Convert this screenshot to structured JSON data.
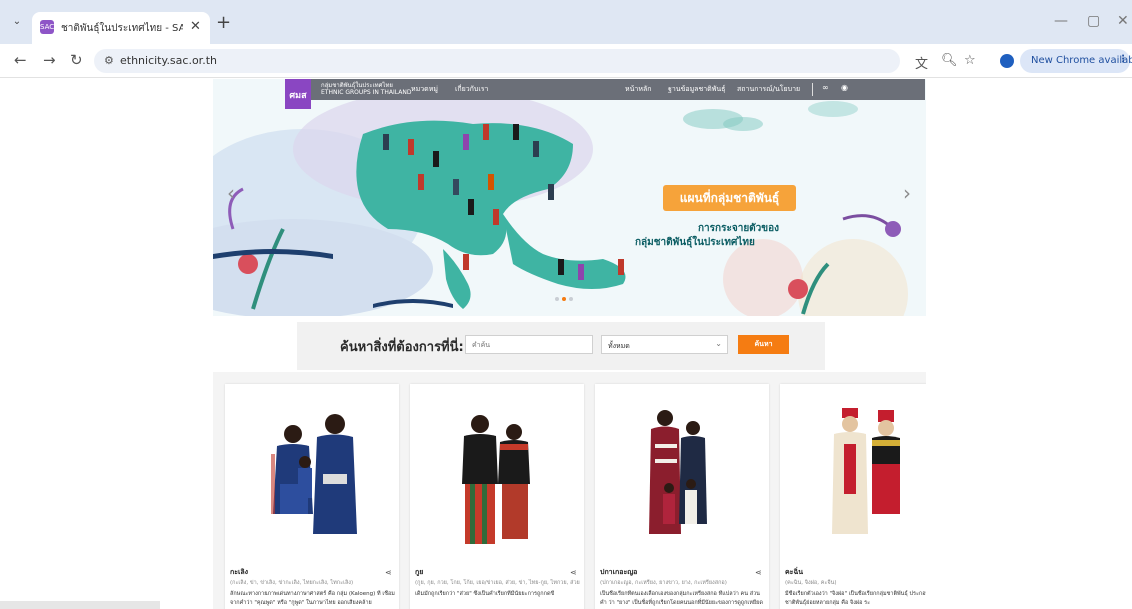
{
  "browser": {
    "tab_title": "ชาติพันธุ์ในประเทศไทย - SAC ETHN",
    "favicon_text": "SAC",
    "url": "ethnicity.sac.or.th",
    "update_label": "New Chrome available",
    "profile_initial": "👤"
  },
  "site_nav": {
    "logo_text": "ศมส",
    "org_name_th": "กลุ่มชาติพันธุ์ในประเทศไทย",
    "org_name_en": "ETHNIC GROUPS IN THAILAND",
    "links_left": [
      "หมวดหมู่",
      "เกี่ยวกับเรา"
    ],
    "links_right": [
      "หน้าหลัก",
      "ฐานข้อมูลชาติพันธุ์",
      "สถานการณ์/นโยบาย"
    ]
  },
  "hero": {
    "title": "แผนที่กลุ่มชาติพันธุ์",
    "subtitle_line1": "การกระจายตัวของ",
    "subtitle_line2": "กลุ่มชาติพันธุ์ในประเทศไทย",
    "slide_count": 3,
    "active_slide": 1
  },
  "search": {
    "label": "ค้นหาสิ่งที่ต้องการที่นี่:",
    "placeholder": "คำค้น",
    "select_value": "ทั้งหมด",
    "button_label": "ค้นหา"
  },
  "cards": [
    {
      "name": "กะเลิง",
      "aliases": "(กะเลิง, ข่า, ข่าเลิง, ข่ากะเลิง, ไทยกะเลิง, ไทกะเลิง)",
      "desc": "ลักษณะทางกายภาพเด่นทางภาษาศาสตร์ คือ กลุ่ม (Kaloeng) ที่ เชื่อมจากคำว่า \"คุณพูด\" หรือ \"กูพูด\" ในภาษาไทย ออกเสียงคล้าย",
      "colors": {
        "shirt": "#1f3a7a",
        "skirt": "#2d4e9e",
        "accent": "#c0392b"
      }
    },
    {
      "name": "กูย",
      "aliases": "(กูย, กุย, กวย, โกย, โก้ย, เยอ/ข่าเยอ, ส่วย, ข่า, ไทย-กูย, ไทกวย, ส่วยกวย, ส่วยกาเลา, เยอะลอย)",
      "desc": "เดิมมักถูกเรียกว่า \"ส่วย\" ซึ่งเป็นคำเรียกที่มีนัยยะการถูกกดขี่",
      "colors": {
        "shirt": "#1a1a1a",
        "skirt": "#c43a2a",
        "accent": "#2f6b3a"
      }
    },
    {
      "name": "ปกาเกอะญอ",
      "aliases": "(ปกาเกอะญอ, กะเหรี่ยง, ยางขาว, ยาง, กะเหรี่ยงสกอ)",
      "desc": "เป็นชื่อเรียกที่ตนเองเลือกเองของกลุ่มกะเหรี่ยงสกอ ที่แปลว่า คน ส่วนคำ ว่า \"ยาง\" เป็นชื่อที่ถูกเรียกโดยคนนอกที่มีนัยยะของการดูถูกเหยียด",
      "colors": {
        "shirt": "#8b1e2d",
        "skirt": "#b0243c",
        "accent": "#f2efe8"
      }
    },
    {
      "name": "คะฉิ่น",
      "aliases": "(คะฉิ่น, จิงผ่อ, คะจีน)",
      "desc": "มีชื่อเรียกตัวเองว่า \"จิงผ่อ\" เป็นชื่อเรียกกลุ่มชาติพันธุ์ ประกอบด้วยกลุ่มชาติพันธุ์ย่อยหลายกลุ่ม คือ จิงผ่อ ระ",
      "colors": {
        "shirt": "#efe4cf",
        "skirt": "#c41e2e",
        "accent": "#1a1a1a"
      }
    }
  ]
}
